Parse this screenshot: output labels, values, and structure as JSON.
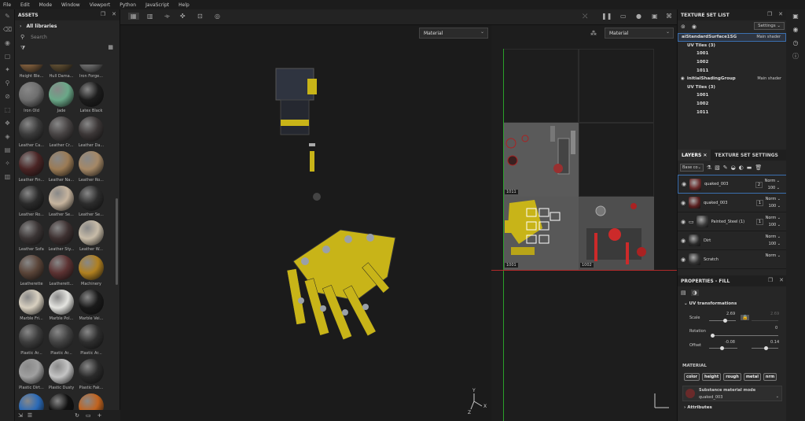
{
  "menu": [
    "File",
    "Edit",
    "Mode",
    "Window",
    "Viewport",
    "Python",
    "JavaScript",
    "Help"
  ],
  "assets": {
    "title": "ASSETS",
    "libraries_label": "All libraries",
    "search_placeholder": "Search",
    "materials": [
      {
        "label": "Height Ble...",
        "color": "#7a5a3a"
      },
      {
        "label": "Hull Dama...",
        "color": "#5a4a30"
      },
      {
        "label": "Iron Forge...",
        "color": "#6a6a6a"
      },
      {
        "label": "Iron Old",
        "color": "#6e6e6e"
      },
      {
        "label": "Jade",
        "color": "#6aa888"
      },
      {
        "label": "Latex Black",
        "color": "#1c1c1c"
      },
      {
        "label": "Leather Ca...",
        "color": "#3a3a3a"
      },
      {
        "label": "Leather Cr...",
        "color": "#474343"
      },
      {
        "label": "Leather Da...",
        "color": "#3b3636"
      },
      {
        "label": "Leather Fin...",
        "color": "#4a2424"
      },
      {
        "label": "Leather Na...",
        "color": "#9b7b55"
      },
      {
        "label": "Leather Ro...",
        "color": "#a58866"
      },
      {
        "label": "Leather Ro...",
        "color": "#2a2a2a"
      },
      {
        "label": "Leather Se...",
        "color": "#c6b49e"
      },
      {
        "label": "Leather Se...",
        "color": "#2c2c2c"
      },
      {
        "label": "Leather Sofa",
        "color": "#3a3434"
      },
      {
        "label": "Leather Sty...",
        "color": "#3d3030"
      },
      {
        "label": "Leather W...",
        "color": "#c8bca8"
      },
      {
        "label": "Leatherette",
        "color": "#5a4438"
      },
      {
        "label": "Leatherett...",
        "color": "#5c3232"
      },
      {
        "label": "Machinery",
        "color": "#b08020"
      },
      {
        "label": "Marble Fri...",
        "color": "#d8d0c0"
      },
      {
        "label": "Marble Pol...",
        "color": "#e4e4e0"
      },
      {
        "label": "Marble Vei...",
        "color": "#1a1a1a"
      },
      {
        "label": "Plastic Ar...",
        "color": "#3c3c3c"
      },
      {
        "label": "Plastic Ar...",
        "color": "#424242"
      },
      {
        "label": "Plastic Ar...",
        "color": "#2e2e2e"
      },
      {
        "label": "Plastic Dirt...",
        "color": "#a0a0a0"
      },
      {
        "label": "Plastic Dusty",
        "color": "#c4c4c4"
      },
      {
        "label": "Plastic Fak...",
        "color": "#2a2a2a"
      },
      {
        "label": "Plastic Glo...",
        "color": "#2a6ab8"
      },
      {
        "label": "Plastic Glo...",
        "color": "#111111"
      },
      {
        "label": "Plastic Glo...",
        "color": "#c2631e"
      }
    ]
  },
  "viewport": {
    "left_mode": "Material",
    "right_mode": "Material",
    "uv_tiles": [
      "1011",
      "1001",
      "1002"
    ]
  },
  "texture_set_list": {
    "title": "TEXTURE SET LIST",
    "settings_label": "Settings",
    "sets": [
      {
        "name": "aiStandardSurface1SG",
        "shader": "Main shader",
        "uv_label": "UV Tiles (3)",
        "tiles": [
          "1001",
          "1002",
          "1011"
        ]
      },
      {
        "name": "initialShadingGroup",
        "shader": "Main shader",
        "uv_label": "UV Tiles (3)",
        "tiles": [
          "1001",
          "1002",
          "1011"
        ]
      }
    ]
  },
  "layers": {
    "tab_layers": "LAYERS",
    "tab_settings": "TEXTURE SET SETTINGS",
    "channel": "Base co",
    "items": [
      {
        "name": "quaked_003",
        "blend": "Norm",
        "opacity": "100",
        "count": "2",
        "thumb": "#6a2a2a"
      },
      {
        "name": "quaked_003",
        "blend": "Norm",
        "opacity": "100",
        "count": "1",
        "thumb": "#5a2020"
      },
      {
        "name": "Painted_Steel (1)",
        "blend": "Norm",
        "opacity": "100",
        "count": "1",
        "thumb": "#3a3a3a"
      },
      {
        "name": "Dirt",
        "blend": "Norm",
        "opacity": "100",
        "count": "",
        "thumb": "#2a2a2a"
      },
      {
        "name": "Scratch",
        "blend": "Norm",
        "opacity": "",
        "count": "",
        "thumb": "#333333"
      }
    ]
  },
  "properties": {
    "title": "PROPERTIES - FILL",
    "uv_title": "UV transformations",
    "scale_label": "Scale",
    "scale_value": "2.69",
    "scale_value2": "2.69",
    "rotation_label": "Rotation",
    "rotation_value": "0",
    "offset_label": "Offset",
    "offset_x": "-0.08",
    "offset_y": "0.14",
    "material_title": "MATERIAL",
    "chips": [
      "color",
      "height",
      "rough",
      "metal",
      "nrm"
    ],
    "mode_label": "Substance material mode",
    "mode_value": "quaked_003",
    "attributes_label": "Attributes"
  },
  "colors": {
    "accent": "#3b6fb0",
    "yellow": "#c8b418",
    "orange": "#e08a1e"
  }
}
